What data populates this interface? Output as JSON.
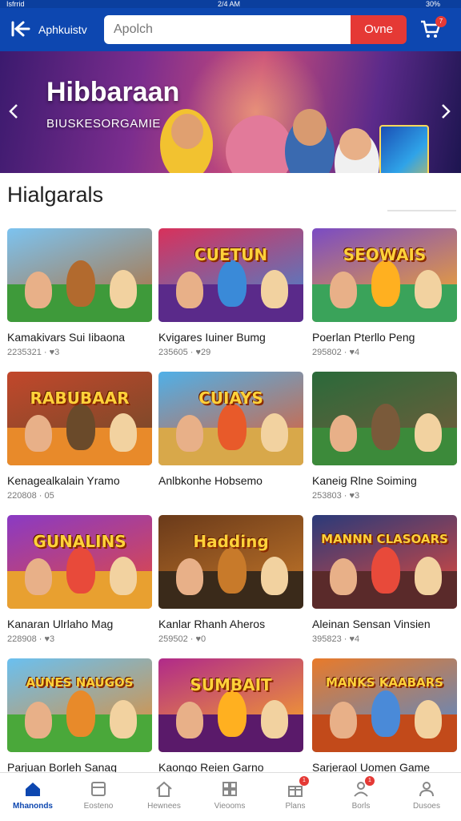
{
  "status_bar": {
    "left": "Isfrrid",
    "time": "2/4 AM",
    "battery": "30%"
  },
  "app_bar": {
    "title": "Aphkuistv",
    "back_icon": "arrow-left-icon",
    "cart_icon": "cart-icon",
    "cart_count": "7"
  },
  "search": {
    "placeholder": "Apolch",
    "button_label": "Ovne"
  },
  "banner": {
    "title": "Hibbaraan",
    "subtitle": "BIUSKESORGAMIE",
    "prev_icon": "chevron-left-icon",
    "next_icon": "chevron-right-icon"
  },
  "section": {
    "title": "Hialgarals"
  },
  "games": [
    {
      "title": "Kamakivars Sui Iibaona",
      "meta": "2235321 · ♥3",
      "logo": "",
      "sky": "#7cc3f0",
      "ground": "#3e9a3a",
      "accent": "#b26a2e"
    },
    {
      "title": "Kvigares Iuiner Bumg",
      "meta": "235605 · ♥29",
      "logo": "CUETUN",
      "sky": "#d8315b",
      "ground": "#5a2a8a",
      "accent": "#3a8ad8"
    },
    {
      "title": "Poerlan Pterllo Peng",
      "meta": "295802 · ♥4",
      "logo": "SEOWAIS",
      "sky": "#7a4bc4",
      "ground": "#3aa35a",
      "accent": "#ffb020"
    },
    {
      "title": "Kenagealkalain Yramo",
      "meta": "220808 · 05",
      "logo": "RABUBAAR",
      "sky": "#c2472b",
      "ground": "#e88a2a",
      "accent": "#6a4a2a"
    },
    {
      "title": "Anlbkonhe Hobsemo",
      "meta": "",
      "logo": "CUIAYS",
      "sky": "#4fb0e8",
      "ground": "#d8a84a",
      "accent": "#e85a2a"
    },
    {
      "title": "Kaneig Rlne Soiming",
      "meta": "253803 · ♥3",
      "logo": "",
      "sky": "#2a6a3a",
      "ground": "#3c8a3a",
      "accent": "#7a5a3a"
    },
    {
      "title": "Kanaran Ulrlaho Mag",
      "meta": "228908 · ♥3",
      "logo": "GUNALINS",
      "sky": "#8a3ac4",
      "ground": "#e8a030",
      "accent": "#e84a3a"
    },
    {
      "title": "Kanlar Rhanh Aheros",
      "meta": "259502 · ♥0",
      "logo": "Hadding",
      "sky": "#6a3a1a",
      "ground": "#3a2a1a",
      "accent": "#c87a2a"
    },
    {
      "title": "Aleinan Sensan Vinsien",
      "meta": "395823 · ♥4",
      "logo": "MANNN CLASOARS",
      "sky": "#2a3a7a",
      "ground": "#5a2a2a",
      "accent": "#e84a3a"
    },
    {
      "title": "Parjuan Borleh Sanag",
      "meta": "",
      "logo": "AUNES NAUGOS",
      "sky": "#6ac0f0",
      "ground": "#4aa83a",
      "accent": "#e88a2a"
    },
    {
      "title": "Kaongo Reien Garno",
      "meta": "",
      "logo": "SUMBAIT",
      "sky": "#b02a8a",
      "ground": "#5a1a6a",
      "accent": "#ffb020"
    },
    {
      "title": "Sarjeraol Uomen Game",
      "meta": "",
      "logo": "MANKS KAABARS",
      "sky": "#e87a2a",
      "ground": "#c24a1a",
      "accent": "#4a8ad8"
    }
  ],
  "nav": [
    {
      "label": "Mhanonds",
      "icon": "home-icon",
      "active": true,
      "badge": ""
    },
    {
      "label": "Eosteno",
      "icon": "store-icon",
      "active": false,
      "badge": ""
    },
    {
      "label": "Hewnees",
      "icon": "house-icon",
      "active": false,
      "badge": ""
    },
    {
      "label": "Vieooms",
      "icon": "grid-icon",
      "active": false,
      "badge": ""
    },
    {
      "label": "Plans",
      "icon": "gift-icon",
      "active": false,
      "badge": "1"
    },
    {
      "label": "Borls",
      "icon": "group-icon",
      "active": false,
      "badge": "1"
    },
    {
      "label": "Dusoes",
      "icon": "user-icon",
      "active": false,
      "badge": ""
    }
  ]
}
